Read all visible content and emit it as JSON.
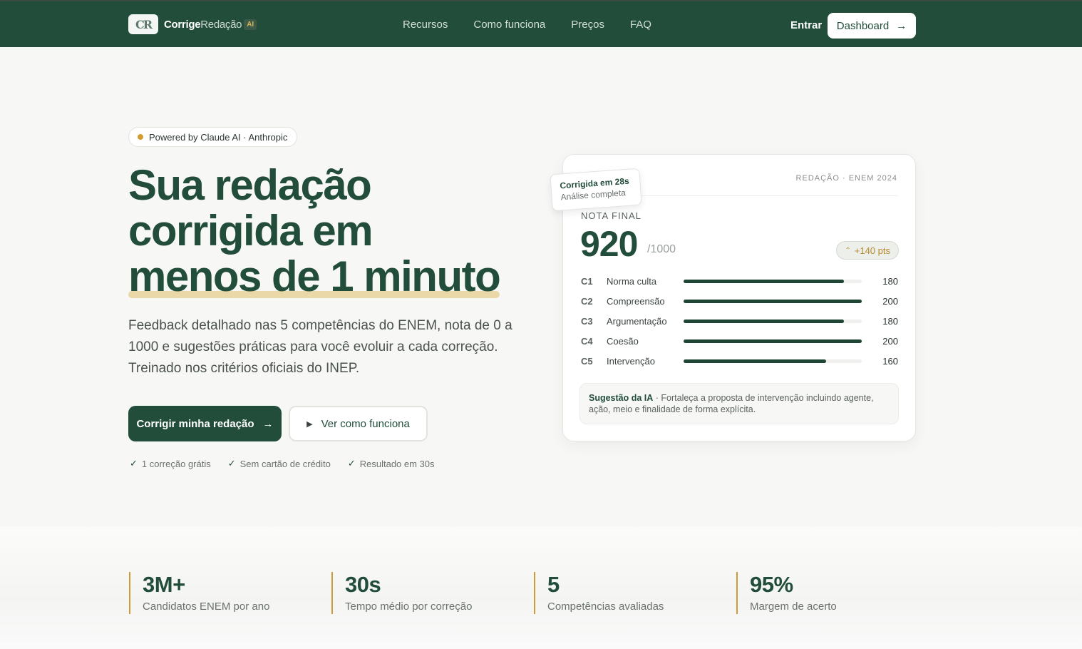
{
  "header": {
    "logo_mark": "CR",
    "brand_strong": "Corrige",
    "brand_light": "Redação",
    "brand_badge": "AI",
    "nav": [
      "Recursos",
      "Como funciona",
      "Preços",
      "FAQ"
    ],
    "login": "Entrar",
    "dashboard": "Dashboard"
  },
  "hero": {
    "pill": "Powered by Claude AI · Anthropic",
    "title_line1": "Sua redação",
    "title_line2": "corrigida em",
    "title_line3": "menos de 1 minuto",
    "lead": "Feedback detalhado nas 5 competências do ENEM, nota de 0 a 1000 e sugestões práticas para você evoluir a cada correção. Treinado nos critérios oficiais do INEP.",
    "cta_primary": "Corrigir minha redação",
    "cta_secondary": "Ver como funciona",
    "checks": [
      "1 correção grátis",
      "Sem cartão de crédito",
      "Resultado em 30s"
    ]
  },
  "card": {
    "tag": "REDAÇÃO · ENEM 2024",
    "sticker_title": "Corrigida em 28s",
    "sticker_sub": "Análise completa",
    "score_label": "NOTA FINAL",
    "score": "920",
    "score_max": "/1000",
    "delta": "+140 pts",
    "competencies": [
      {
        "code": "C1",
        "name": "Norma culta",
        "score": "180",
        "fraction": 0.9
      },
      {
        "code": "C2",
        "name": "Compreensão",
        "score": "200",
        "fraction": 1.0
      },
      {
        "code": "C3",
        "name": "Argumentação",
        "score": "180",
        "fraction": 0.9
      },
      {
        "code": "C4",
        "name": "Coesão",
        "score": "200",
        "fraction": 1.0
      },
      {
        "code": "C5",
        "name": "Intervenção",
        "score": "160",
        "fraction": 0.8
      }
    ],
    "suggestion_label": "Sugestão da IA",
    "suggestion_text": " · Fortaleça a proposta de intervenção incluindo agente, ação, meio e finalidade de forma explícita."
  },
  "stats": [
    {
      "value": "3M+",
      "label": "Candidatos ENEM por ano"
    },
    {
      "value": "30s",
      "label": "Tempo médio por correção"
    },
    {
      "value": "5",
      "label": "Competências avaliadas"
    },
    {
      "value": "95%",
      "label": "Margem de acerto"
    }
  ],
  "colors": {
    "brand": "#214d3a",
    "accent": "#d49b2e",
    "highlight": "#ead8a8"
  },
  "icons": [
    "arrow-right-icon",
    "play-icon",
    "check-icon",
    "chevron-up-icon"
  ]
}
